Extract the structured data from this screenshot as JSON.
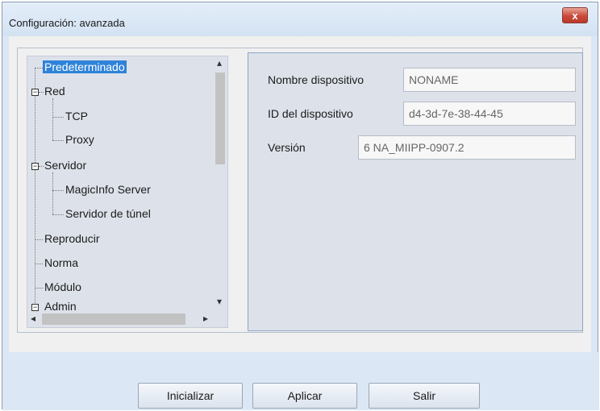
{
  "window": {
    "title": "Configuración: avanzada",
    "close_glyph": "x"
  },
  "tree": {
    "items": [
      {
        "label": "Predeterminado",
        "selected": true
      },
      {
        "label": "Red",
        "expanded": true
      },
      {
        "label": "TCP"
      },
      {
        "label": "Proxy"
      },
      {
        "label": "Servidor",
        "expanded": true
      },
      {
        "label": "MagicInfo Server"
      },
      {
        "label": "Servidor de túnel"
      },
      {
        "label": "Reproducir"
      },
      {
        "label": "Norma"
      },
      {
        "label": "Módulo"
      },
      {
        "label": "Admin"
      }
    ],
    "expander_symbol": "−"
  },
  "form": {
    "device_name": {
      "label": "Nombre dispositivo",
      "value": "NONAME"
    },
    "device_id": {
      "label": "ID del dispositivo",
      "value": "d4-3d-7e-38-44-45"
    },
    "version": {
      "label": "Versión",
      "value": "6 NA_MIIPP-0907.2"
    }
  },
  "buttons": {
    "init": "Inicializar",
    "apply": "Aplicar",
    "exit": "Salir"
  },
  "icons": {
    "scroll_up": "▴",
    "scroll_down": "▾",
    "scroll_left": "◂",
    "scroll_right": "▸"
  },
  "colors": {
    "selection": "#2f83d8",
    "close_button": "#c8493a"
  }
}
